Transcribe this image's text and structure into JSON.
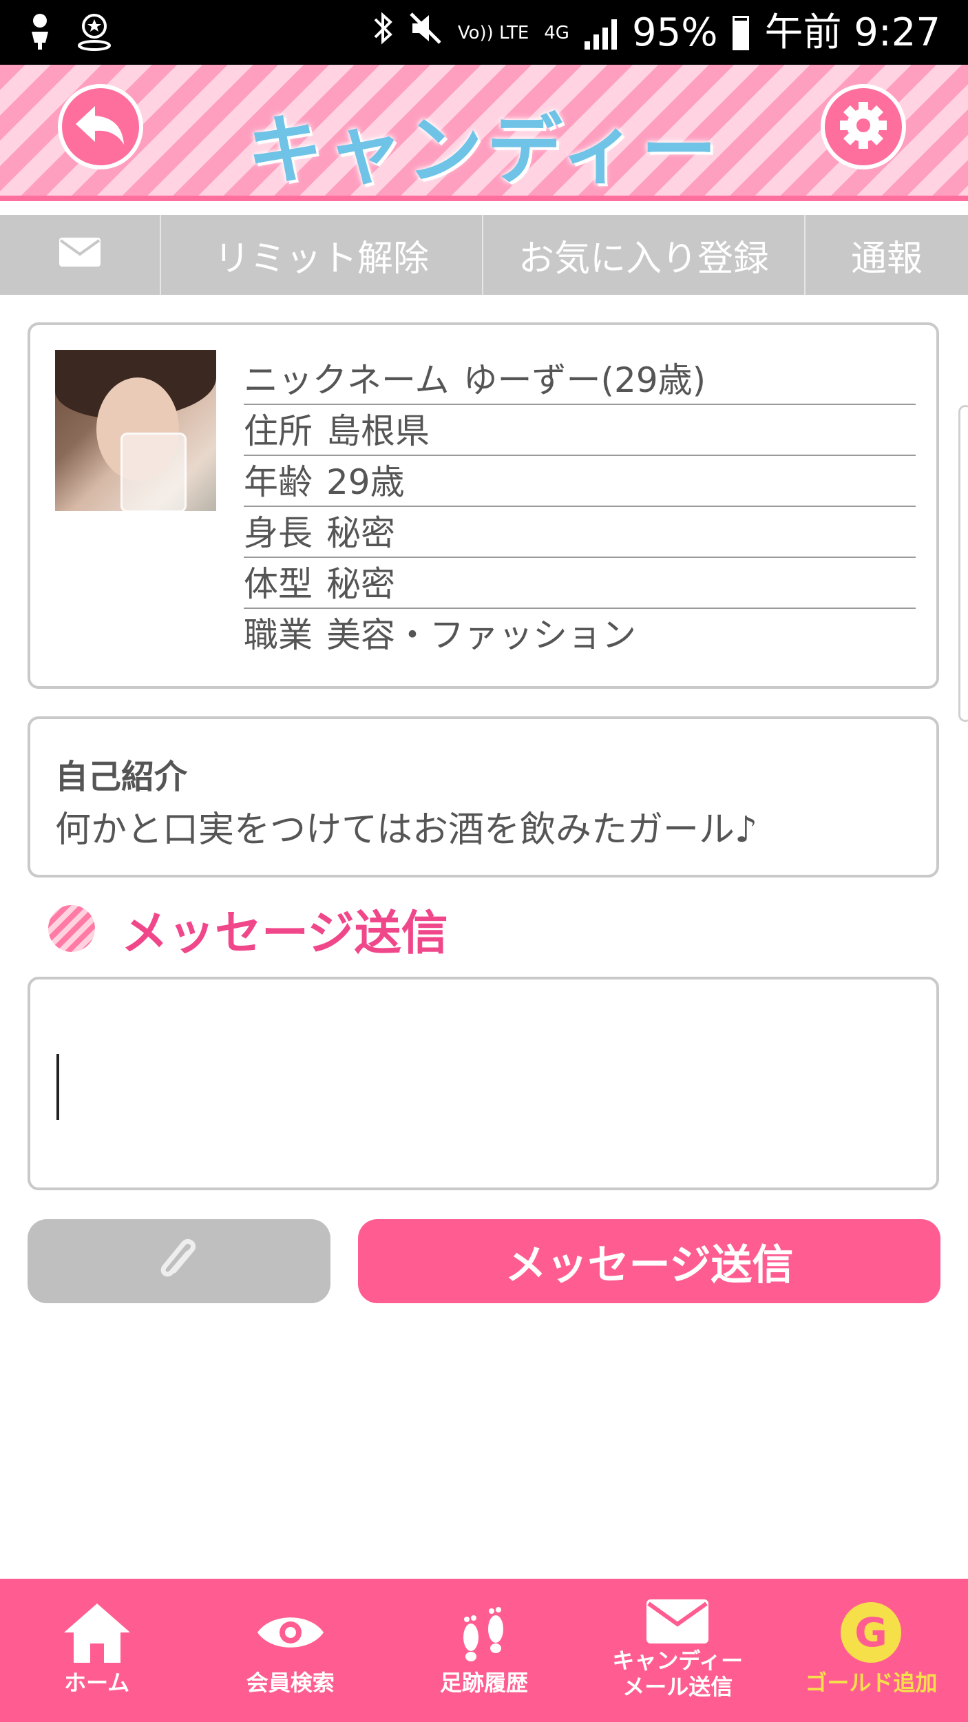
{
  "status_bar": {
    "indicators": [
      "person-pin-icon",
      "location-badge-icon",
      "bluetooth-icon",
      "mute-icon"
    ],
    "volte_label": "Vo)) LTE",
    "network": "4G",
    "battery_percent": "95%",
    "time": "午前 9:27"
  },
  "header": {
    "logo_text": "キャンディー",
    "back_icon": "back-arrow-icon",
    "settings_icon": "gear-icon"
  },
  "tabs": {
    "mail_icon": "envelope-icon",
    "limit_release": "リミット解除",
    "favorite_register": "お気に入り登録",
    "report": "通報"
  },
  "profile": {
    "rows": [
      {
        "label": "ニックネーム",
        "value": "ゆーずー(29歳)"
      },
      {
        "label": "住所",
        "value": "島根県"
      },
      {
        "label": "年齢",
        "value": "29歳"
      },
      {
        "label": "身長",
        "value": "秘密"
      },
      {
        "label": "体型",
        "value": "秘密"
      },
      {
        "label": "職業",
        "value": "美容・ファッション"
      }
    ]
  },
  "intro": {
    "title": "自己紹介",
    "text": "何かと口実をつけてはお酒を飲みたガール♪"
  },
  "message": {
    "section_title": "メッセージ送信",
    "input_value": "",
    "attach_icon": "paperclip-icon",
    "send_label": "メッセージ送信"
  },
  "bottom_nav": {
    "home": "ホーム",
    "member_search": "会員検索",
    "footprints": "足跡履歴",
    "candy_mail_line1": "キャンディー",
    "candy_mail_line2": "メール送信",
    "gold_add": "ゴールド追加",
    "gold_color": "#f5e04a",
    "accent_color": "#ff5d92"
  }
}
